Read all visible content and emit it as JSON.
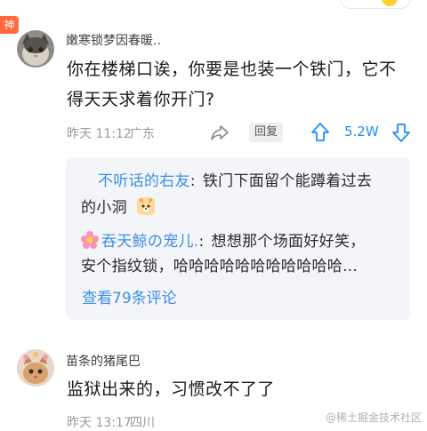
{
  "badge": {
    "label": "神"
  },
  "comment1": {
    "username": "嫩寒锁梦因春暖..",
    "line1": "你在楼梯口诶，你要是也装一个铁门，它不",
    "line2": "得天天求着你开门?",
    "time": "昨天 11:12",
    "location": "广东",
    "reply_label": "回复",
    "like_count": "5.2W"
  },
  "replies": {
    "r1_user": "不听话的右友",
    "r1_colon": ":",
    "r1_text_a": "铁门下面留个能蹲着过去",
    "r1_text_b": "的小洞",
    "r2_user": "吞天鲸の宠儿.",
    "r2_colon": ":",
    "r2_text_a": "想想那个场面好好笑，",
    "r2_text_b": "安个指纹锁，哈哈哈哈哈哈哈哈哈哈哈...",
    "view_more": "查看79条评论"
  },
  "comment2": {
    "username": "苗条的猪尾巴",
    "line1": "监狱出来的，习惯改不了了",
    "time": "昨天 13:17",
    "location": "四川"
  },
  "watermark": "@稀土掘金技术社区",
  "colors": {
    "accent": "#1e8ffa",
    "link": "#3d8fe8",
    "badge": "#ff6a3d"
  },
  "icons": [
    "share-icon",
    "thumb-up-arrow-icon",
    "thumb-down-arrow-icon",
    "dog-emoji-icon",
    "flower-emoji-icon"
  ]
}
